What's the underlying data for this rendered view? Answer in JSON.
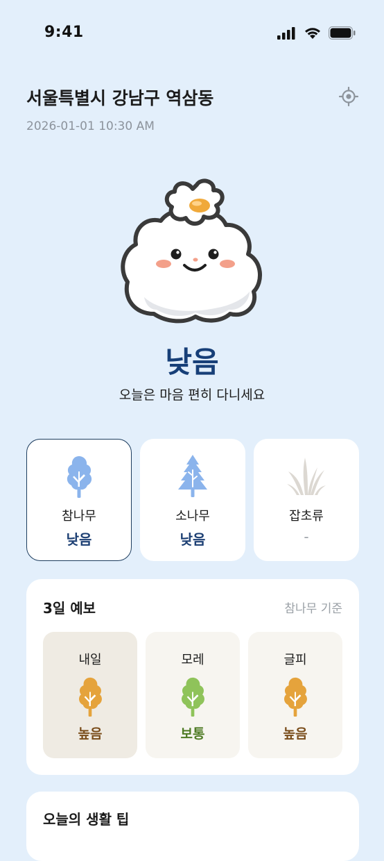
{
  "status_bar": {
    "time": "9:41"
  },
  "header": {
    "location": "서울특별시 강남구 역삼동",
    "timestamp": "2026-01-01 10:30 AM"
  },
  "summary": {
    "level": "낮음",
    "message": "오늘은 마음 편히 다니세요",
    "level_color": "#173f78"
  },
  "pollen_types": [
    {
      "name": "참나무",
      "level": "낮음",
      "icon": "oak-tree-icon",
      "selected": true
    },
    {
      "name": "소나무",
      "level": "낮음",
      "icon": "pine-tree-icon",
      "selected": false
    },
    {
      "name": "잡초류",
      "level": "-",
      "icon": "weed-grass-icon",
      "selected": false
    }
  ],
  "forecast": {
    "title": "3일 예보",
    "basis": "참나무 기준",
    "days": [
      {
        "day": "내일",
        "level": "높음",
        "color": "#e5a33c"
      },
      {
        "day": "모레",
        "level": "보통",
        "color": "#8fc35a"
      },
      {
        "day": "글피",
        "level": "높음",
        "color": "#e5a33c"
      }
    ]
  },
  "tips": {
    "title": "오늘의 생활 팁"
  }
}
